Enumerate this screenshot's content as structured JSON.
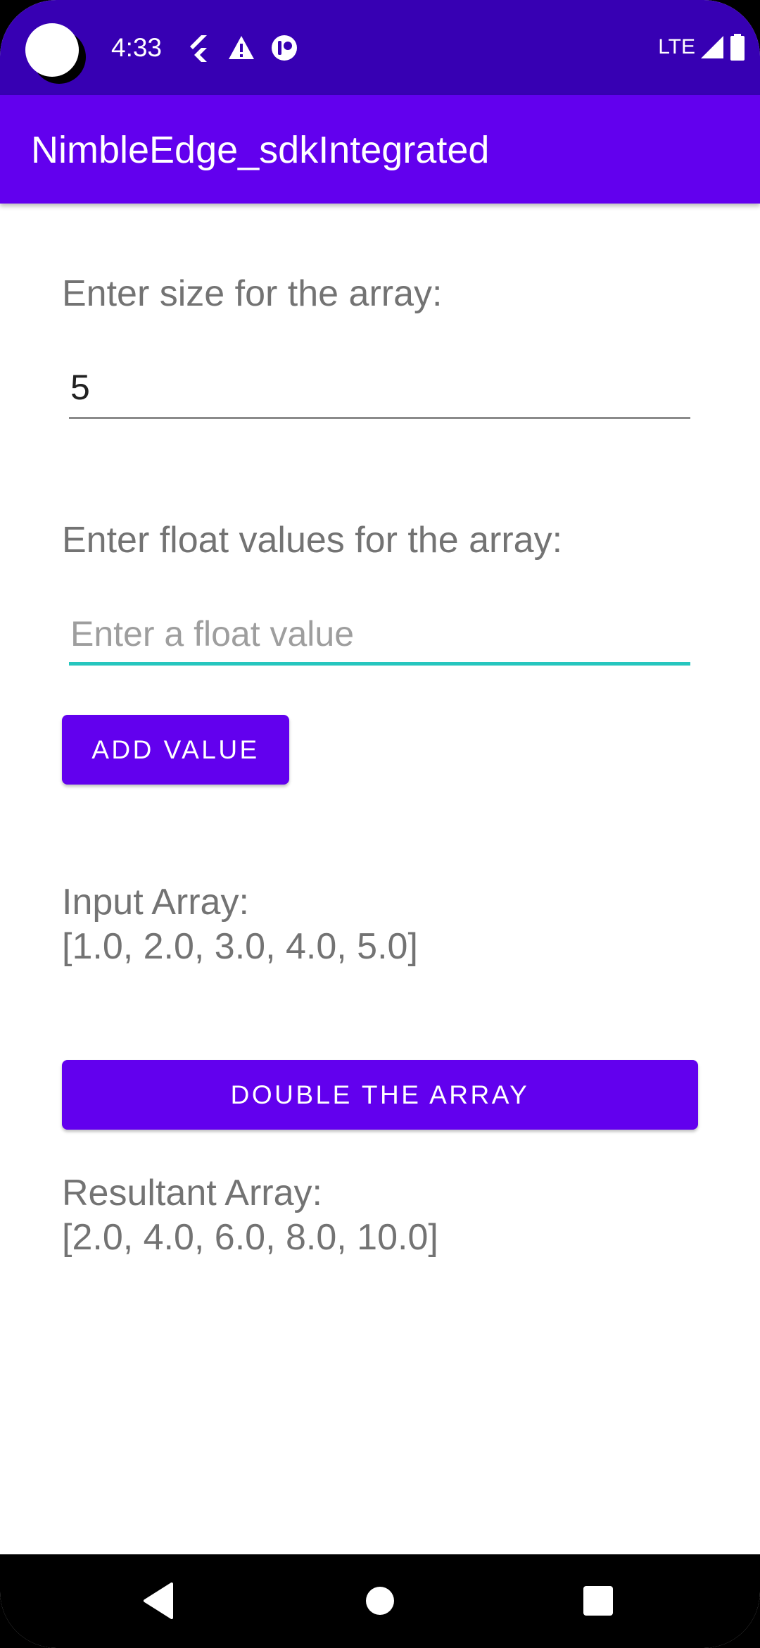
{
  "status_bar": {
    "time": "4:33",
    "network_label": "LTE",
    "icons": [
      "camera-cutout",
      "flutter-icon",
      "warning-icon",
      "notification-icon",
      "signal-icon",
      "battery-icon"
    ]
  },
  "app_bar": {
    "title": "NimbleEdge_sdkIntegrated"
  },
  "size_section": {
    "label": "Enter size for the array:",
    "input_value": "5"
  },
  "float_section": {
    "label": "Enter float values for the array:",
    "input_value": "",
    "input_placeholder": "Enter a float value",
    "add_button_label": "ADD VALUE"
  },
  "input_array": {
    "label": "Input Array:",
    "value": "[1.0, 2.0, 3.0, 4.0, 5.0]"
  },
  "double_button_label": "DOUBLE THE ARRAY",
  "result_array": {
    "label": "Resultant Array:",
    "value": "[2.0, 4.0, 6.0, 8.0, 10.0]"
  },
  "nav_bar": {
    "icons": [
      "back-icon",
      "home-icon",
      "recents-icon"
    ]
  },
  "colors": {
    "status_bar": "#3700B3",
    "primary": "#6200EE",
    "focus_underline": "#26C6BE",
    "label_text": "#737373",
    "placeholder": "#9E9E9E"
  }
}
